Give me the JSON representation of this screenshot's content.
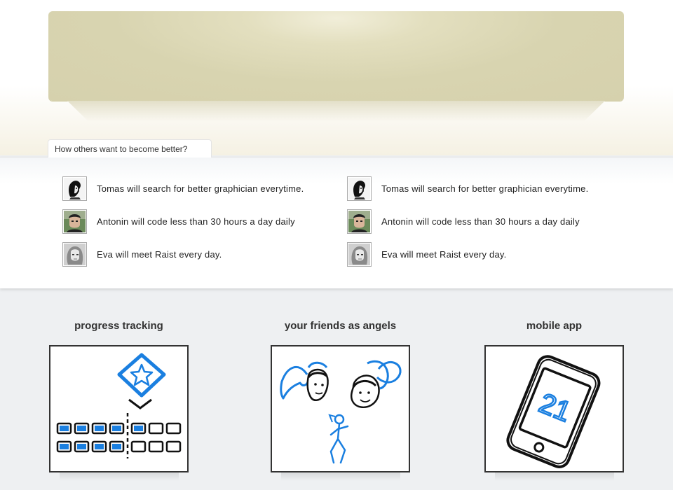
{
  "others": {
    "tab_label": "How others want to become better?",
    "left": [
      {
        "name": "Tomas",
        "text": "Tomas will search for better graphician everytime.",
        "avatar_icon": "tomas-avatar"
      },
      {
        "name": "Antonin",
        "text": "Antonin will code less than 30 hours a day daily",
        "avatar_icon": "antonin-avatar"
      },
      {
        "name": "Eva",
        "text": "Eva will meet Raist every day.",
        "avatar_icon": "eva-avatar"
      }
    ],
    "right": [
      {
        "name": "Tomas",
        "text": "Tomas will search for better graphician everytime.",
        "avatar_icon": "tomas-avatar"
      },
      {
        "name": "Antonin",
        "text": "Antonin will code less than 30 hours a day daily",
        "avatar_icon": "antonin-avatar"
      },
      {
        "name": "Eva",
        "text": "Eva will meet Raist every day.",
        "avatar_icon": "eva-avatar"
      }
    ]
  },
  "features": [
    {
      "title": "progress tracking",
      "icon": "progress-tracking-icon"
    },
    {
      "title": "your friends as angels",
      "icon": "angel-friends-icon"
    },
    {
      "title": "mobile app",
      "icon": "mobile-app-icon",
      "phone_number": "21"
    }
  ],
  "colors": {
    "banner": "#d8d4b0",
    "sketch_blue": "#1a7fe0",
    "text": "#222222"
  }
}
